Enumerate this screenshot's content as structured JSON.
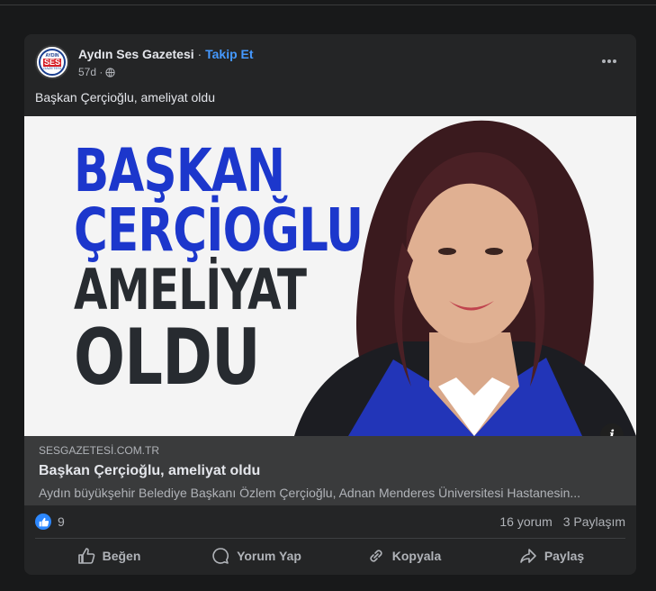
{
  "post": {
    "page_name": "Aydın Ses Gazetesi",
    "separator": " · ",
    "follow_label": "Takip Et",
    "time": "57d ·",
    "caption": "Başkan Çerçioğlu, ameliyat oldu",
    "avatar": {
      "top": "AYDIN",
      "mid": "SES",
      "bottom": "GAZETESİ"
    }
  },
  "image": {
    "lines": [
      "BAŞKAN",
      "ÇERÇİOĞLU",
      "AMELİYAT",
      "OLDU"
    ],
    "colors": {
      "blue": "#1c37cc",
      "dark": "#272b30"
    }
  },
  "link": {
    "domain": "SESGAZETESİ.COM.TR",
    "title": "Başkan Çerçioğlu, ameliyat oldu",
    "description": "Aydın büyükşehir Belediye Başkanı Özlem Çerçioğlu, Adnan Menderes Üniversitesi Hastanesin..."
  },
  "stats": {
    "likes": "9",
    "comments": "16 yorum",
    "shares": "3 Paylaşım"
  },
  "actions": {
    "like": "Beğen",
    "comment": "Yorum Yap",
    "copy": "Kopyala",
    "share": "Paylaş"
  },
  "icons": {
    "more": "more-horizontal-icon",
    "globe": "globe-icon",
    "info": "info-icon",
    "like": "thumbs-up-icon",
    "comment": "comment-icon",
    "copy": "link-icon",
    "share": "share-icon"
  }
}
